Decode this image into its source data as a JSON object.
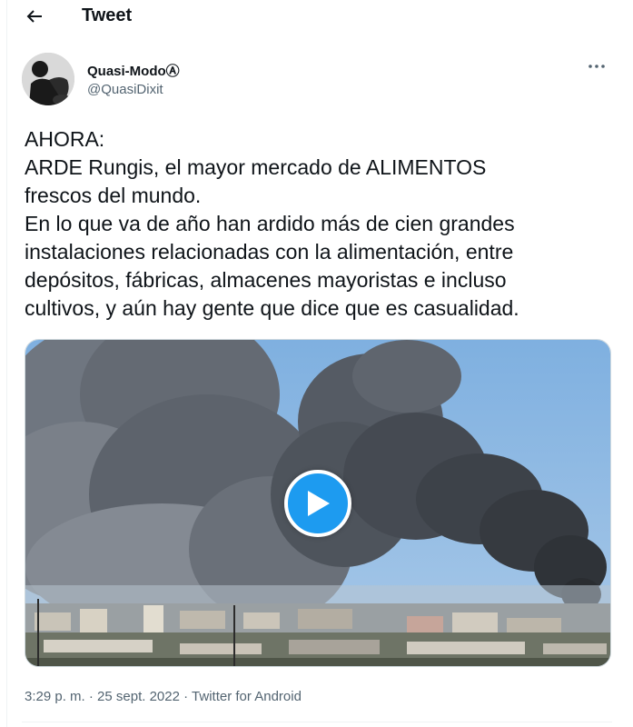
{
  "header": {
    "back_icon": "arrow-left-icon",
    "title": "Tweet"
  },
  "author": {
    "display_name": "Quasi-ModoⒶ",
    "handle": "@QuasiDixit",
    "avatar_icon": "avatar-image",
    "more_icon": "more-horizontal-icon"
  },
  "tweet": {
    "lines": [
      "AHORA:",
      "ARDE Rungis, el mayor mercado de ALIMENTOS",
      "frescos del mundo.",
      "En lo que va de año han ardido más de cien grandes",
      "instalaciones relacionadas con la alimentación, entre",
      "depósitos, fábricas, almacenes mayoristas e incluso",
      "cultivos, y aún hay gente que dice que es casualidad."
    ]
  },
  "media": {
    "type": "video",
    "play_icon": "play-icon",
    "accent_color": "#1d9bf0"
  },
  "meta": {
    "time": "3:29 p. m.",
    "separator": "·",
    "date": "25 sept. 2022",
    "source": "Twitter for Android"
  }
}
